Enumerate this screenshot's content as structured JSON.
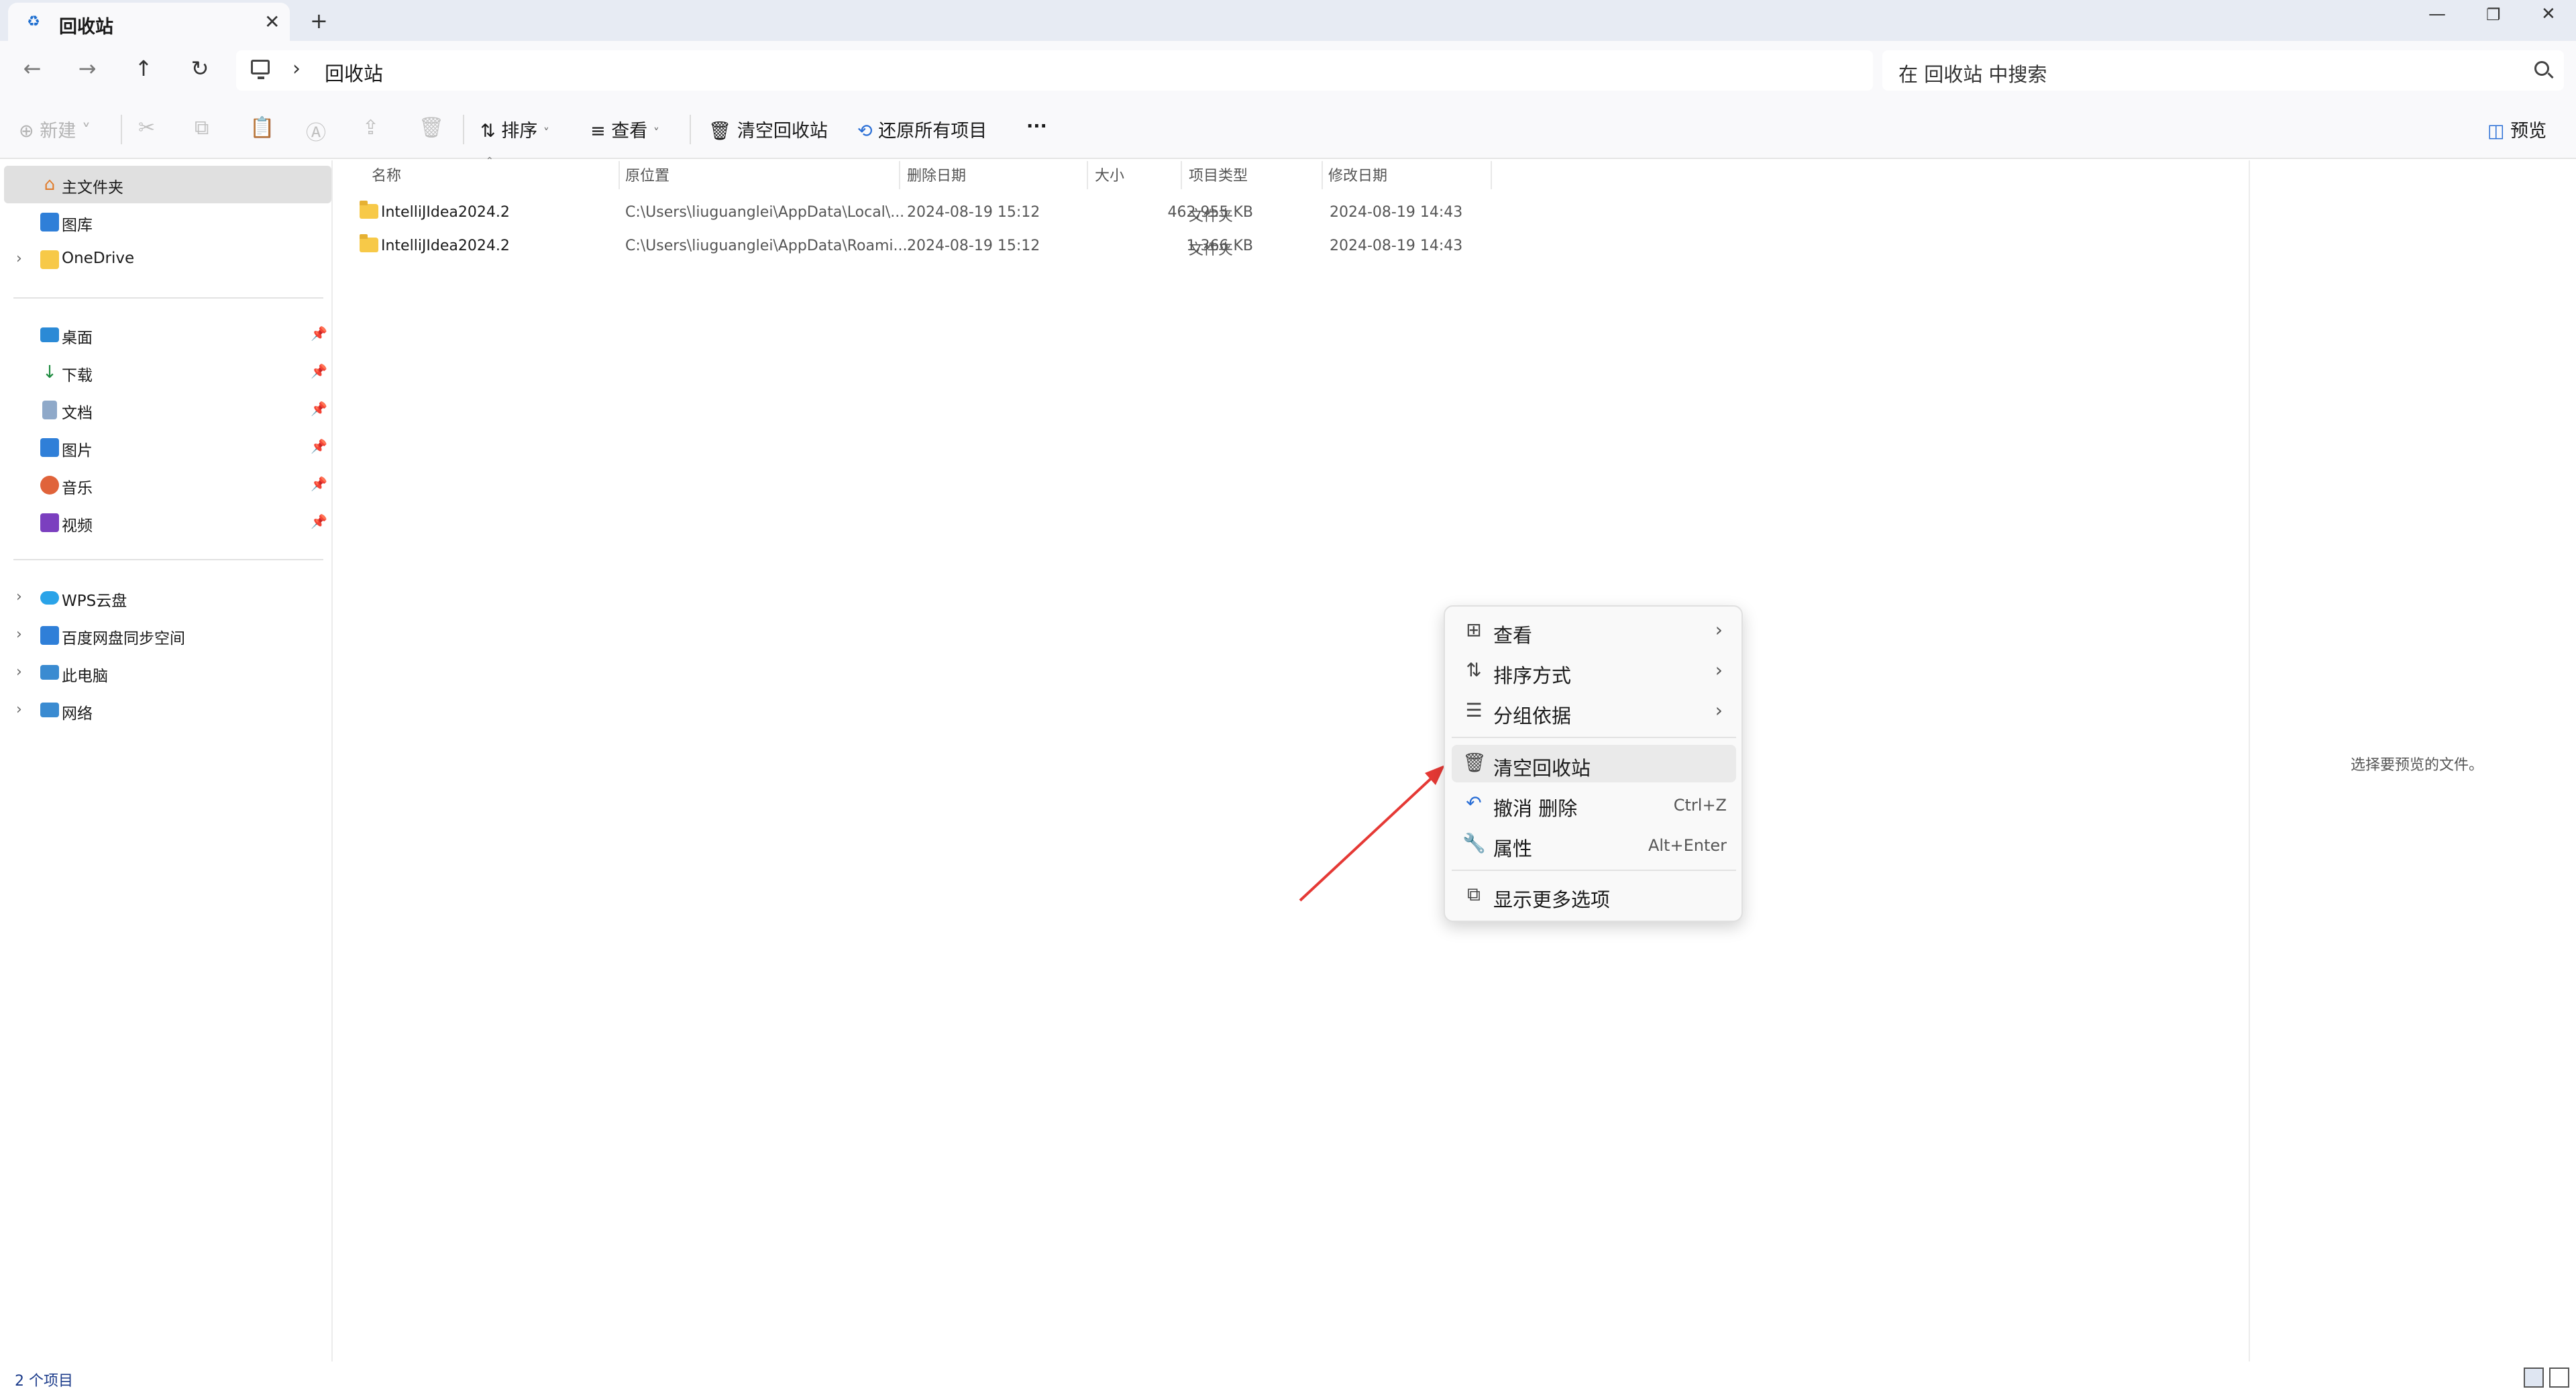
{
  "window": {
    "tab_title": "回收站",
    "tab_icon": "recycle-bin-icon",
    "close_glyph": "✕",
    "new_tab_glyph": "+"
  },
  "address": {
    "location": "回收站",
    "search_placeholder": "在 回收站 中搜索"
  },
  "toolbar": {
    "new_label": "新建",
    "sort_label": "排序",
    "view_label": "查看",
    "empty_label": "清空回收站",
    "restore_label": "还原所有项目",
    "more_label": "···",
    "preview_label": "预览"
  },
  "sidebar": {
    "home": "主文件夹",
    "gallery": "图库",
    "onedrive": "OneDrive",
    "desktop": "桌面",
    "downloads": "下载",
    "documents": "文档",
    "pictures": "图片",
    "music": "音乐",
    "videos": "视频",
    "wps": "WPS云盘",
    "baidu": "百度网盘同步空间",
    "thispc": "此电脑",
    "network": "网络"
  },
  "columns": {
    "name": "名称",
    "original_location": "原位置",
    "date_deleted": "删除日期",
    "size": "大小",
    "item_type": "项目类型",
    "date_modified": "修改日期"
  },
  "files": [
    {
      "name": "IntelliJIdea2024.2",
      "location": "C:\\Users\\liuguanglei\\AppData\\Local\\...",
      "deleted": "2024-08-19 15:12",
      "size": "462,955 KB",
      "type": "文件夹",
      "modified": "2024-08-19 14:43"
    },
    {
      "name": "IntelliJIdea2024.2",
      "location": "C:\\Users\\liuguanglei\\AppData\\Roami...",
      "deleted": "2024-08-19 15:12",
      "size": "1,366 KB",
      "type": "文件夹",
      "modified": "2024-08-19 14:43"
    }
  ],
  "preview": {
    "placeholder": "选择要预览的文件。"
  },
  "context_menu": {
    "view": "查看",
    "sort_by": "排序方式",
    "group_by": "分组依据",
    "empty": "清空回收站",
    "undo_delete": "撤消 删除",
    "undo_shortcut": "Ctrl+Z",
    "properties": "属性",
    "properties_shortcut": "Alt+Enter",
    "more_options": "显示更多选项"
  },
  "status": {
    "item_count": "2 个项目"
  },
  "colors": {
    "accent": "#2b6fd6",
    "annotation_arrow": "#e53935",
    "folder": "#f7c948"
  }
}
